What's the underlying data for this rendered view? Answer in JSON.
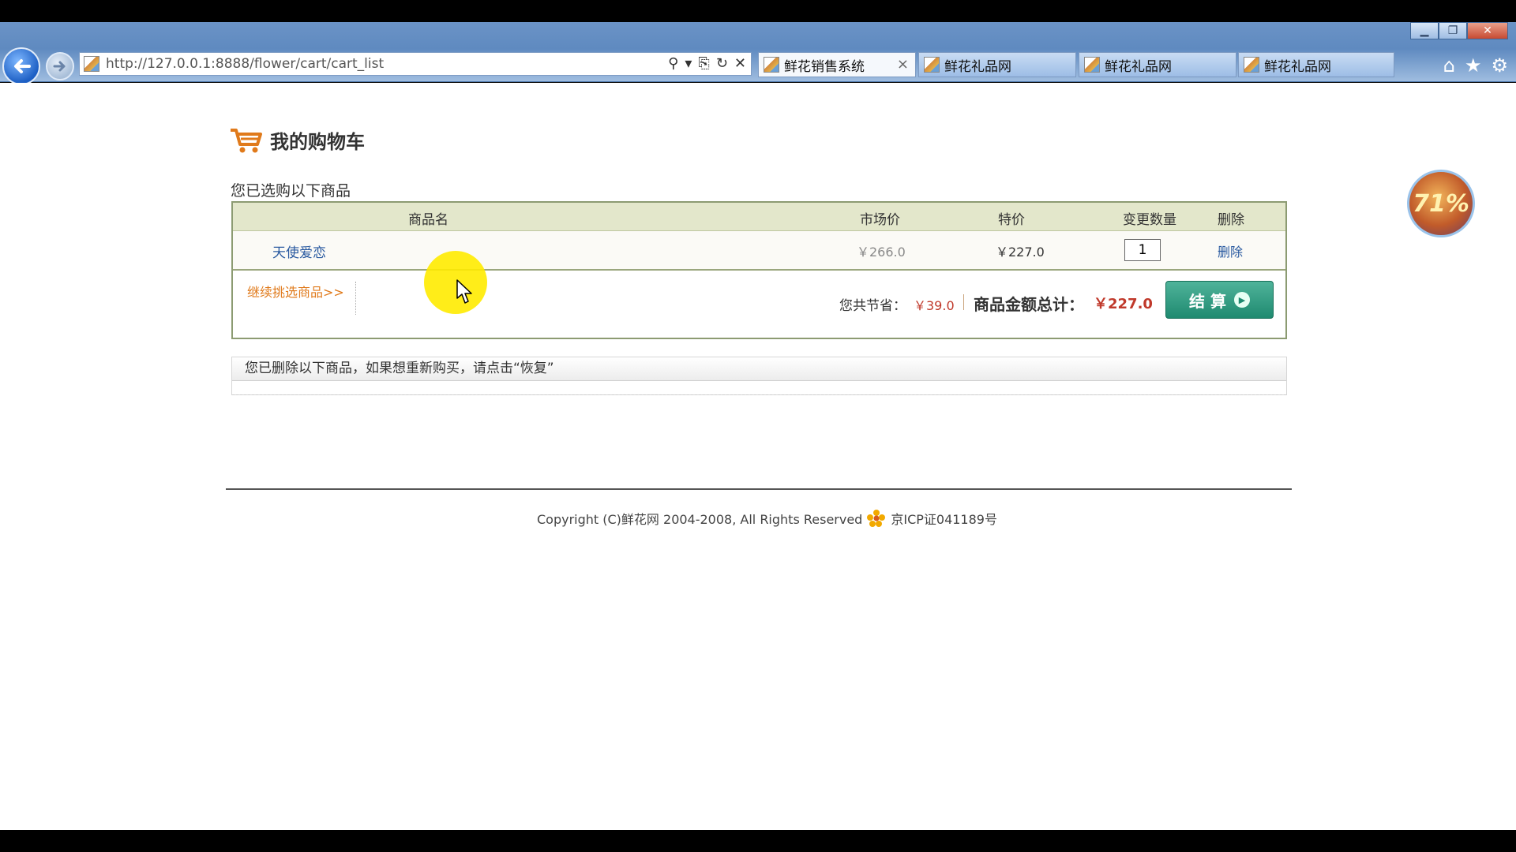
{
  "window": {
    "controls": {
      "minimize": "▁",
      "maximize": "❐",
      "close": "✕"
    }
  },
  "browser": {
    "url": "http://127.0.0.1:8888/flower/cart/cart_list",
    "address_icons": [
      "search-icon",
      "dropdown-icon",
      "compat-icon",
      "refresh-icon",
      "stop-icon"
    ],
    "tabs": [
      {
        "label": "鲜花销售系统",
        "active": true,
        "close": "×"
      },
      {
        "label": "鲜花礼品网",
        "active": false
      },
      {
        "label": "鲜花礼品网",
        "active": false
      },
      {
        "label": "鲜花礼品网",
        "active": false
      }
    ],
    "toolbar_icons": [
      "home-icon",
      "favorites-star-icon",
      "settings-gear-icon"
    ]
  },
  "page": {
    "title": "我的购物车",
    "selected_label": "您已选购以下商品",
    "table": {
      "headers": {
        "name": "商品名",
        "market_price": "市场价",
        "special_price": "特价",
        "qty": "变更数量",
        "delete": "删除"
      },
      "rows": [
        {
          "name": "天使爱恋",
          "market_price": "￥266.0",
          "special_price": "￥227.0",
          "qty": "1",
          "delete": "删除"
        }
      ]
    },
    "continue_link": "继续挑选商品>>",
    "save_label": "您共节省：",
    "save_value": "￥39.0",
    "total_label": "商品金额总计：",
    "total_value": "￥227.0",
    "checkout_label": "结 算",
    "deleted_notice": "您已删除以下商品，如果想重新购买，请点击“恢复”",
    "copyright": "Copyright (C)鲜花网 2004-2008, All Rights Reserved",
    "icp": "京ICP证041189号",
    "float_badge": "71%"
  },
  "colors": {
    "accent_orange": "#e07a1b",
    "price_red": "#c0392b",
    "link_blue": "#2a5aa0",
    "checkout_green": "#1f8a70",
    "table_header_bg": "#e3e7cb"
  }
}
